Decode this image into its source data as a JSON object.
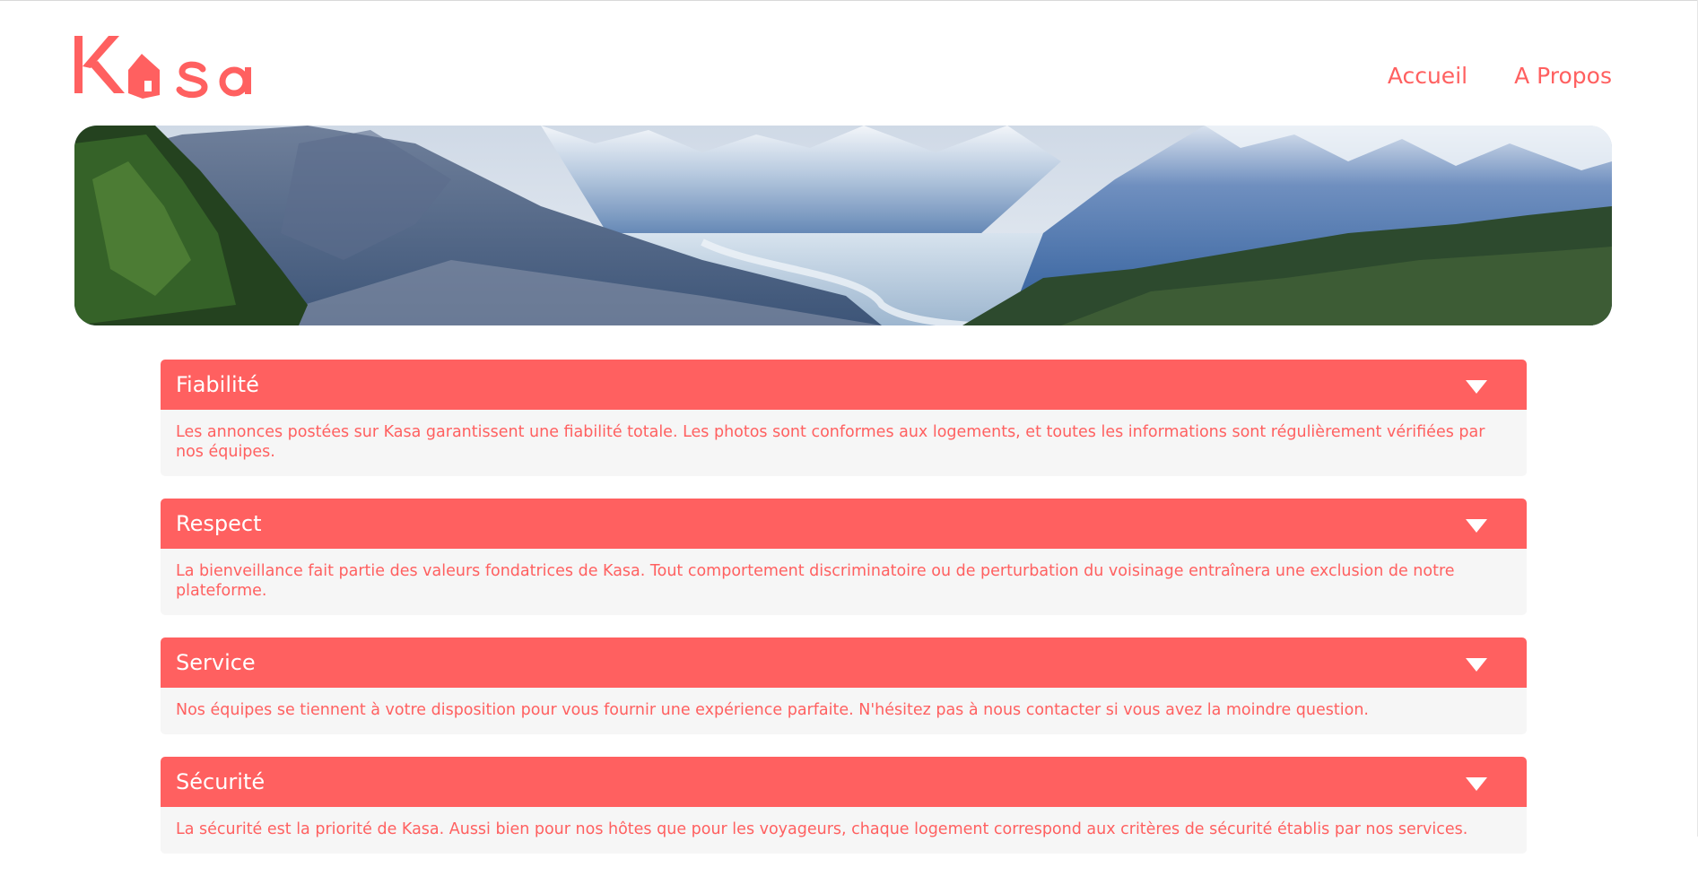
{
  "brand": {
    "name": "Kasa",
    "color": "#FF6060"
  },
  "nav": {
    "items": [
      {
        "label": "Accueil"
      },
      {
        "label": "A Propos"
      }
    ]
  },
  "banner": {
    "alt": "mountain-landscape"
  },
  "accordion": {
    "items": [
      {
        "title": "Fiabilité",
        "body": "Les annonces postées sur Kasa garantissent une fiabilité totale. Les photos sont conformes aux logements, et toutes les informations sont régulièrement vérifiées par nos équipes."
      },
      {
        "title": "Respect",
        "body": "La bienveillance fait partie des valeurs fondatrices de Kasa. Tout comportement discriminatoire ou de perturbation du voisinage entraînera une exclusion de notre plateforme."
      },
      {
        "title": "Service",
        "body": "Nos équipes se tiennent à votre disposition pour vous fournir une expérience parfaite. N'hésitez pas à nous contacter si vous avez la moindre question."
      },
      {
        "title": "Sécurité",
        "body": "La sécurité est la priorité de Kasa. Aussi bien pour nos hôtes que pour les voyageurs, chaque logement correspond aux critères de sécurité établis par nos services."
      }
    ]
  }
}
